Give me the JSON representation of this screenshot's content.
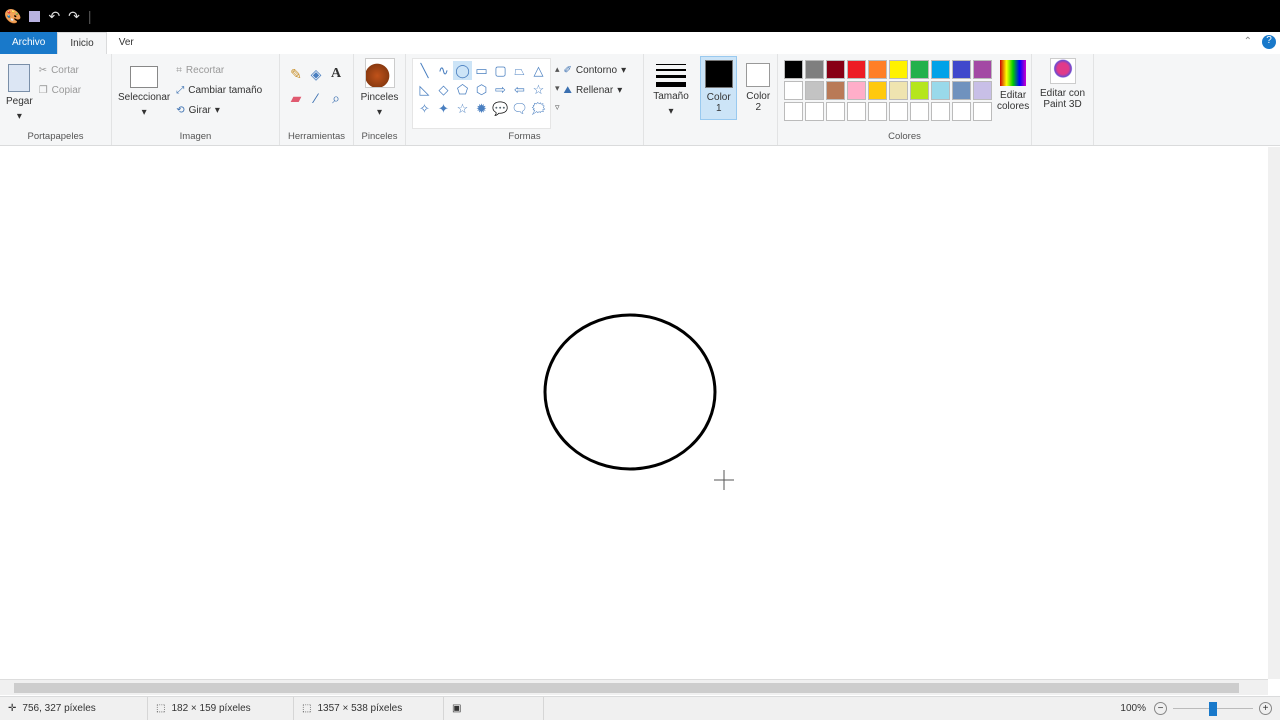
{
  "titlebar": {
    "icons": [
      "paint-icon",
      "save-icon",
      "undo-icon",
      "redo-icon"
    ]
  },
  "tabs": [
    {
      "label": "Archivo"
    },
    {
      "label": "Inicio"
    },
    {
      "label": "Ver"
    }
  ],
  "ribbon": {
    "clipboard": {
      "label": "Portapapeles",
      "paste": "Pegar",
      "cut": "Cortar",
      "copy": "Copiar"
    },
    "image": {
      "label": "Imagen",
      "select": "Seleccionar",
      "crop": "Recortar",
      "resize": "Cambiar tamaño",
      "rotate": "Girar"
    },
    "tools": {
      "label": "Herramientas"
    },
    "brushes": {
      "label": "Pinceles"
    },
    "shapes": {
      "label": "Formas",
      "outline": "Contorno",
      "fill": "Rellenar",
      "glyphs": [
        "╲",
        "∿",
        "◯",
        "▭",
        "▢",
        "⏢",
        "△",
        "◺",
        "◇",
        "⬠",
        "⬡",
        "⇨",
        "⇦",
        "☆",
        "✧",
        "✦",
        "☆",
        "✹",
        "💬",
        "🗨",
        "🗯"
      ]
    },
    "size": {
      "label": "Tamaño"
    },
    "color1": {
      "label": "Color",
      "sub": "1",
      "value": "#000000"
    },
    "color2": {
      "label": "Color",
      "sub": "2",
      "value": "#ffffff"
    },
    "colors": {
      "label": "Colores",
      "edit": "Editar colores",
      "palette": [
        "#000000",
        "#7f7f7f",
        "#880015",
        "#ed1c24",
        "#ff7f27",
        "#fff200",
        "#22b14c",
        "#00a2e8",
        "#3f48cc",
        "#a349a4",
        "#ffffff",
        "#c3c3c3",
        "#b97a57",
        "#ffaec9",
        "#ffc90e",
        "#efe4b0",
        "#b5e61d",
        "#99d9ea",
        "#7092be",
        "#c8bfe7",
        "#ffffff",
        "#ffffff",
        "#ffffff",
        "#ffffff",
        "#ffffff",
        "#ffffff",
        "#ffffff",
        "#ffffff",
        "#ffffff",
        "#ffffff"
      ]
    },
    "paint3d": {
      "label": "Editar con Paint 3D"
    }
  },
  "status": {
    "cursor": "756, 327 píxeles",
    "selection": "182 × 159 píxeles",
    "canvas": "1357 × 538 píxeles",
    "zoom": "100%",
    "zoom_fraction": 0.5
  }
}
